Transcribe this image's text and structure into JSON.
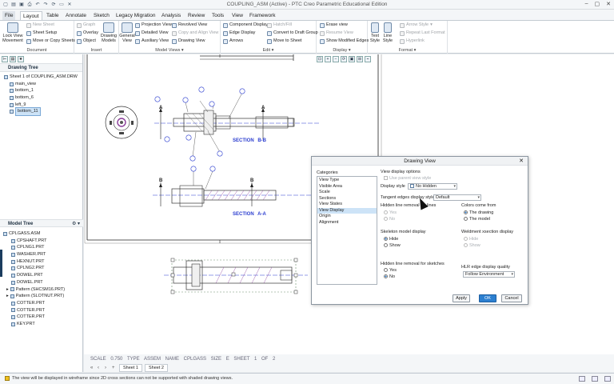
{
  "app": {
    "title": "COUPLING_ASM (Active) - PTC Creo Parametric Educational Edition"
  },
  "tabs": [
    "File",
    "Layout",
    "Table",
    "Annotate",
    "Sketch",
    "Legacy Migration",
    "Analysis",
    "Review",
    "Tools",
    "View",
    "Framework"
  ],
  "active_tab": "Layout",
  "ribbon": {
    "document": {
      "label": "Document",
      "lock_view_movement": "Lock View Movement",
      "new_sheet": "New Sheet",
      "sheet_setup": "Sheet Setup",
      "move_copy_sheets": "Move or Copy Sheets"
    },
    "insert": {
      "label": "Insert",
      "graph": "Graph",
      "overlay": "Overlay",
      "object": "Object",
      "drawing_models": "Drawing Models"
    },
    "model_views": {
      "label": "Model Views",
      "general_view": "General View",
      "projection_view": "Projection View",
      "detailed_view": "Detailed View",
      "auxiliary_view": "Auxiliary View",
      "revolved_view": "Revolved View",
      "copy_align_view": "Copy and Align View",
      "drawing_view": "Drawing View"
    },
    "edit": {
      "label": "Edit",
      "component_display": "Component Display",
      "edge_display": "Edge Display",
      "arrows": "Arrows",
      "hatch_fill": "Hatch/Fill",
      "convert_draft_group": "Convert to Draft Group",
      "move_to_sheet": "Move to Sheet"
    },
    "display": {
      "label": "Display",
      "erase_view": "Erase view",
      "resume_view": "Resume View",
      "show_modified_edges": "Show Modified Edges"
    },
    "format": {
      "label": "Format",
      "text_style": "Text Style",
      "line_style": "Line Style",
      "arrow_style": "Arrow Style",
      "repeat_last_format": "Repeat Last Format",
      "hyperlink": "Hyperlink"
    }
  },
  "drawing_tree": {
    "title": "Drawing Tree",
    "items": [
      "Sheet 1 of COUPLING_ASM.DRW",
      "main_view",
      "bottom_1",
      "bottom_6",
      "left_9",
      "bottom_11"
    ],
    "selected": "bottom_11"
  },
  "model_tree": {
    "title": "Model Tree",
    "items": [
      "CPLGASS.ASM",
      "CPSHAFT.PRT",
      "CPLNG1.PRT",
      "WASHER.PRT",
      "HEXNUT.PRT",
      "CPLNG2.PRT",
      "DOWEL.PRT",
      "DOWEL.PRT",
      "Pattern (SHCSM16.PRT)",
      "Pattern (SLOTNUT.PRT)",
      "COTTER.PRT",
      "COTTER.PRT",
      "COTTER.PRT",
      "KEY.PRT"
    ]
  },
  "canvas": {
    "labels": {
      "section_bb": "SECTION  B-B",
      "section_aa": "SECTION  A-A",
      "label_a": "A",
      "label_b": "B"
    },
    "status": {
      "scale_label": "SCALE",
      "scale": "0.750",
      "type_label": "TYPE",
      "type": "ASSEM",
      "name_label": "NAME",
      "name": "CPLGASS",
      "size_label": "SIZE",
      "size": "E",
      "sheet_label": "SHEET",
      "sheet": "1",
      "of_label": "OF",
      "of": "2"
    },
    "sheets": [
      "Sheet 1",
      "Sheet 2"
    ]
  },
  "dialog": {
    "title": "Drawing View",
    "categories_label": "Categories",
    "categories": [
      "View Type",
      "Visible Area",
      "Scale",
      "Sections",
      "View States",
      "View Display",
      "Origin",
      "Alignment"
    ],
    "selected_category": "View Display",
    "view_display_options": "View display options",
    "use_parent_style": "Use parent view style",
    "display_style_label": "Display style",
    "display_style_value": "No Hidden",
    "tangent_edges_label": "Tangent edges display style",
    "tangent_edges_value": "Default",
    "hidden_line_removal_label": "Hidden line removal for lines",
    "colors_from_label": "Colors come from",
    "colors_options": [
      "The drawing",
      "The model"
    ],
    "skeleton_label": "Skeleton model display",
    "skeleton_options": [
      "Hide",
      "Show"
    ],
    "weldment_label": "Weldment xsection display",
    "weldment_options": [
      "Hide",
      "Show"
    ],
    "hidden_sketch_label": "Hidden line removal for sketches",
    "yes_no": [
      "Yes",
      "No"
    ],
    "hlr_label": "HLR edge display quality",
    "hlr_value": "Follow Environment",
    "apply": "Apply",
    "ok": "OK",
    "cancel": "Cancel"
  },
  "message": "The view will be displayed in wireframe since 2D cross sections can not be supported with shaded drawing views."
}
